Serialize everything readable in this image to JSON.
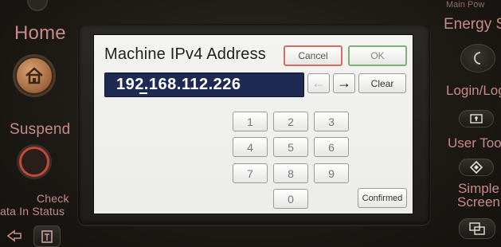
{
  "panel": {
    "home_label": "Home",
    "suspend_label": "Suspend",
    "check_status_label_1": "Check",
    "check_status_label_2": "Status",
    "data_in_label": "ata In",
    "energy_label": "Energy Sa",
    "main_power_label": "Main Pow",
    "login_label": "Login/Log",
    "user_tools_label": "User Tool",
    "simple_screen_label_1": "Simple",
    "simple_screen_label_2": "Screen"
  },
  "dialog": {
    "title": "Machine IPv4 Address",
    "cancel_label": "Cancel",
    "ok_label": "OK",
    "address_value": "192.168.112.226",
    "back_arrow": "←",
    "forward_arrow": "→",
    "clear_label": "Clear",
    "confirmed_label": "Confirmed",
    "keys": [
      "1",
      "2",
      "3",
      "4",
      "5",
      "6",
      "7",
      "8",
      "9",
      "0"
    ]
  },
  "colors": {
    "panel_text": "#c88a86",
    "field_background": "#1f2a52",
    "cancel_border": "#d86a66",
    "ok_border": "#7fb07a"
  }
}
